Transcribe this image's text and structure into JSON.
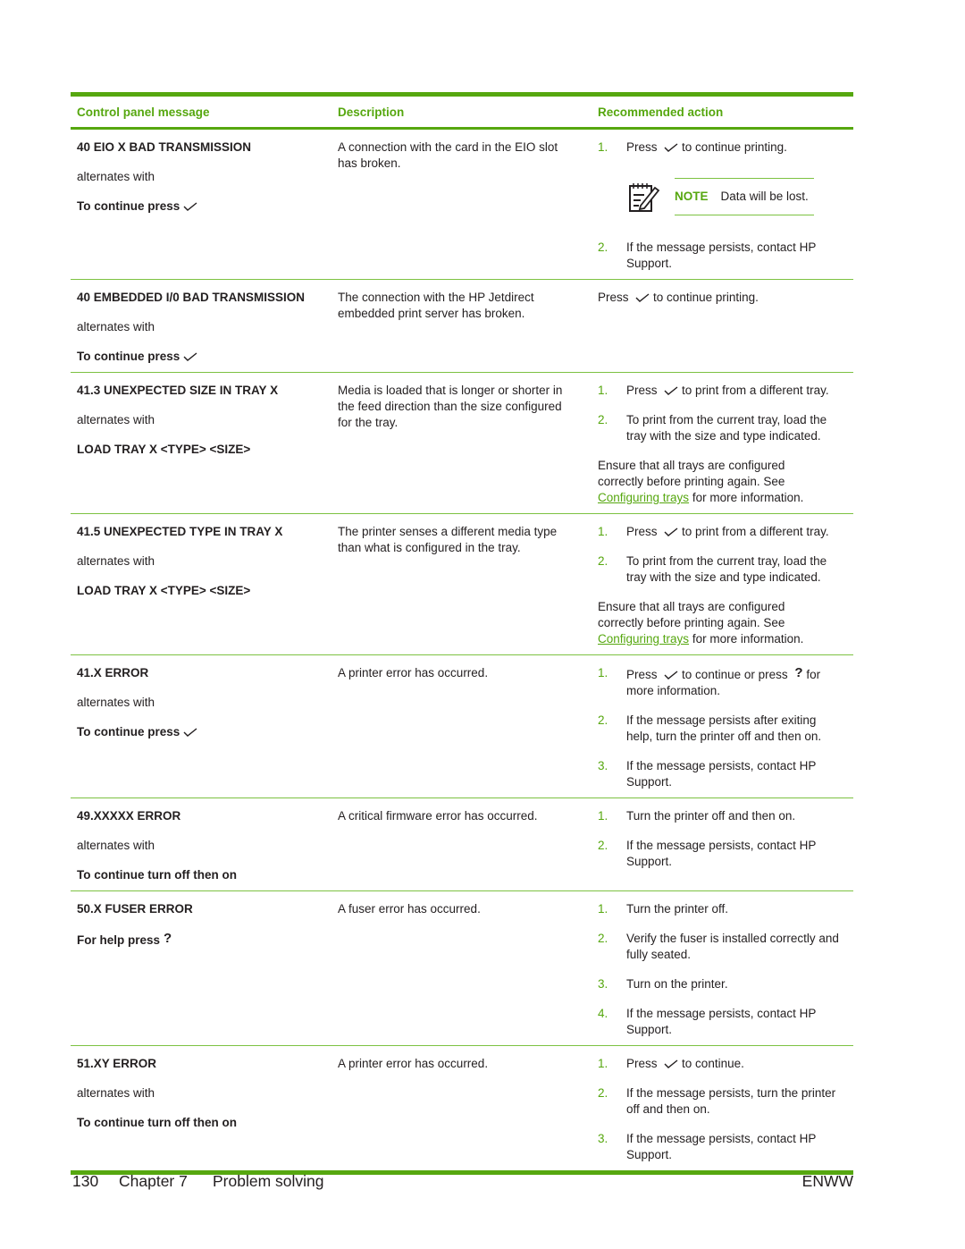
{
  "colors": {
    "accent": "#56a70f",
    "rule_light": "#7dc242",
    "text": "#231f20"
  },
  "table": {
    "headers": [
      "Control panel message",
      "Description",
      "Recommended action"
    ],
    "rows": [
      {
        "message": "40 EIO X BAD TRANSMISSION",
        "alternates": "alternates with",
        "message2": "To continue press",
        "message2_icon": "checkmark-icon",
        "description": "A connection with the card in the EIO slot has broken.",
        "steps": [
          {
            "num": "1.",
            "before": "Press",
            "icon": "checkmark-icon",
            "after": "to continue printing."
          },
          {
            "num": "2.",
            "text": "If the message persists, contact HP Support."
          }
        ],
        "note": {
          "label": "NOTE",
          "text": "Data will be lost.",
          "icon": "note-pad-icon"
        }
      },
      {
        "message": "40 EMBEDDED I/0 BAD TRANSMISSION",
        "alternates": "alternates with",
        "message2": "To continue press",
        "message2_icon": "checkmark-icon",
        "description": "The connection with the HP Jetdirect embedded print server has broken.",
        "action_plain": {
          "before": "Press",
          "icon": "checkmark-icon",
          "after": "to continue printing."
        }
      },
      {
        "message": "41.3 UNEXPECTED SIZE IN TRAY X",
        "alternates": "alternates with",
        "message2": "LOAD TRAY X <TYPE> <SIZE>",
        "description": "Media is loaded that is longer or shorter in the feed direction than the size configured for the tray.",
        "steps": [
          {
            "num": "1.",
            "before": "Press",
            "icon": "checkmark-icon",
            "after": "to print from a different tray."
          },
          {
            "num": "2.",
            "text": "To print from the current tray, load the tray with the size and type indicated."
          }
        ],
        "para": {
          "before": "Ensure that all trays are configured correctly before printing again. See",
          "link": "Configuring trays",
          "after": "for more information."
        }
      },
      {
        "message": "41.5 UNEXPECTED TYPE IN TRAY X",
        "alternates": "alternates with",
        "message2": "LOAD TRAY X <TYPE> <SIZE>",
        "description": "The printer senses a different media type than what is configured in the tray.",
        "steps": [
          {
            "num": "1.",
            "before": "Press",
            "icon": "checkmark-icon",
            "after": "to print from a different tray."
          },
          {
            "num": "2.",
            "text": "To print from the current tray, load the tray with the size and type indicated."
          }
        ],
        "para": {
          "before": "Ensure that all trays are configured correctly before printing again. See",
          "link": "Configuring trays",
          "after": "for more information."
        }
      },
      {
        "message": "41.X ERROR",
        "alternates": "alternates with",
        "message2": "To continue press",
        "message2_icon": "checkmark-icon",
        "description": "A printer error has occurred.",
        "steps": [
          {
            "num": "1.",
            "before": "Press",
            "icon": "checkmark-icon",
            "after": "to continue or press",
            "icon2": "help-question-icon",
            "after2": "for more information."
          },
          {
            "num": "2.",
            "text": "If the message persists after exiting help, turn the printer off and then on."
          },
          {
            "num": "3.",
            "text": "If the message persists, contact HP Support."
          }
        ]
      },
      {
        "message": "49.XXXXX ERROR",
        "alternates": "alternates with",
        "message2": "To continue turn off then on",
        "description": "A critical firmware error has occurred.",
        "steps": [
          {
            "num": "1.",
            "text": "Turn the printer off and then on."
          },
          {
            "num": "2.",
            "text": "If the message persists, contact HP Support."
          }
        ]
      },
      {
        "message": "50.X FUSER ERROR",
        "message2": "For help press",
        "message2_icon": "help-question-icon",
        "description": "A fuser error has occurred.",
        "steps": [
          {
            "num": "1.",
            "text": "Turn the printer off."
          },
          {
            "num": "2.",
            "text": "Verify the fuser is installed correctly and fully seated."
          },
          {
            "num": "3.",
            "text": "Turn on the printer."
          },
          {
            "num": "4.",
            "text": "If the message persists, contact HP Support."
          }
        ]
      },
      {
        "message": "51.XY ERROR",
        "alternates": "alternates with",
        "message2": "To continue turn off then on",
        "description": "A printer error has occurred.",
        "steps": [
          {
            "num": "1.",
            "before": "Press",
            "icon": "checkmark-icon",
            "after": "to continue."
          },
          {
            "num": "2.",
            "text": "If the message persists, turn the printer off and then on."
          },
          {
            "num": "3.",
            "text": "If the message persists, contact HP Support."
          }
        ]
      }
    ]
  },
  "footer": {
    "page_number": "130",
    "chapter": "Chapter 7",
    "section": "Problem solving",
    "locale": "ENWW"
  }
}
